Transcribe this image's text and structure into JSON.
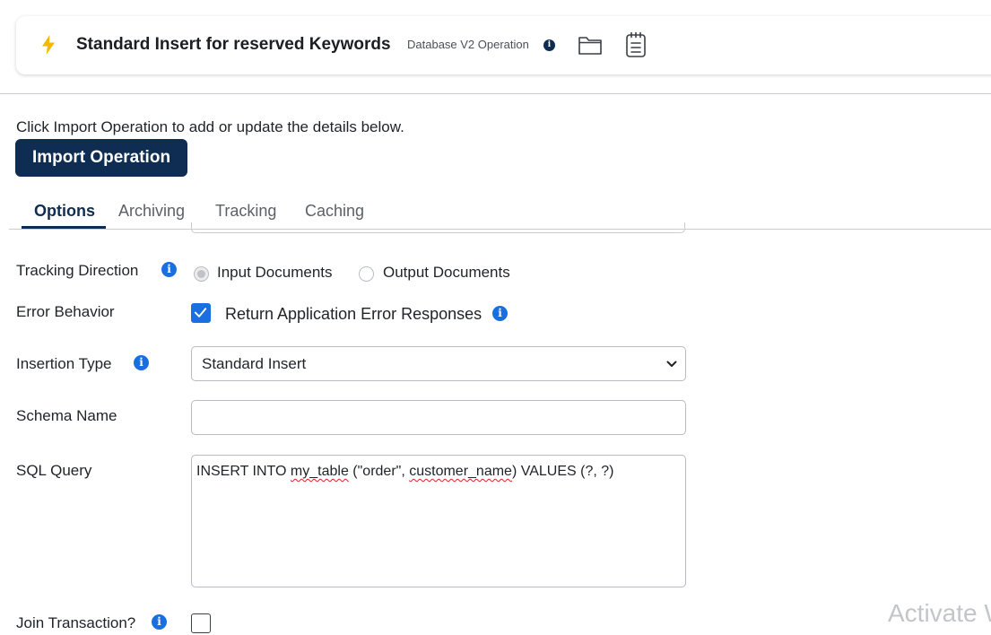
{
  "header": {
    "title": "Standard Insert for reserved Keywords",
    "operation_type": "Database V2 Operation",
    "icons": [
      "lightning-icon",
      "info-icon",
      "folder-icon",
      "notepad-icon"
    ],
    "accent_color": "#f5b800"
  },
  "intro": {
    "hint": "Click Import Operation to add or update the details below.",
    "import_button": "Import Operation"
  },
  "tabs": [
    {
      "label": "Options",
      "active": true
    },
    {
      "label": "Archiving",
      "active": false
    },
    {
      "label": "Tracking",
      "active": false
    },
    {
      "label": "Caching",
      "active": false
    }
  ],
  "form": {
    "tracking_direction": {
      "label": "Tracking Direction",
      "options": [
        "Input Documents",
        "Output Documents"
      ],
      "selected": "Input Documents"
    },
    "error_behavior": {
      "label": "Error Behavior",
      "checkbox_label": "Return Application Error Responses",
      "checked": true
    },
    "insertion_type": {
      "label": "Insertion Type",
      "value": "Standard Insert"
    },
    "schema_name": {
      "label": "Schema Name",
      "value": ""
    },
    "sql_query": {
      "label": "SQL Query",
      "part1": "INSERT INTO ",
      "part2": "my_table",
      "part3": " (\"order\", ",
      "part4": "customer_name",
      "part5": ") VALUES (?, ?)"
    },
    "join_transaction": {
      "label": "Join Transaction?",
      "checked": false
    }
  },
  "watermark": "Activate W",
  "colors": {
    "primary": "#0f2d52",
    "info_blue": "#1a6fe0"
  }
}
